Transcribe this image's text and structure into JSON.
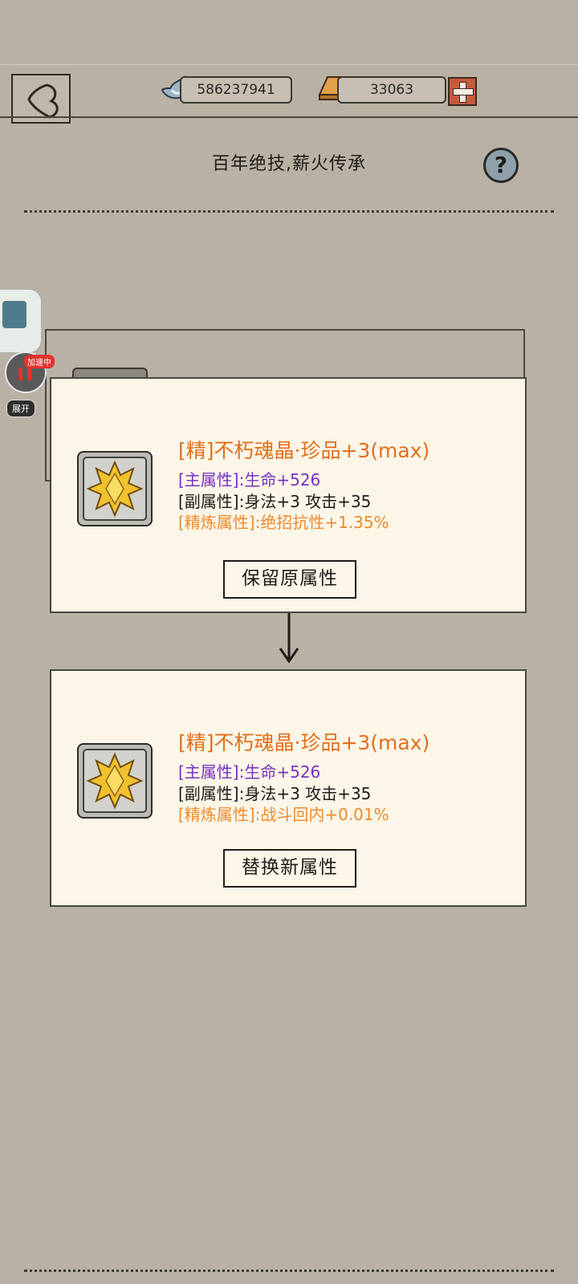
{
  "header": {
    "silver_amount": "586237941",
    "gold_amount": "33063"
  },
  "page_title": "百年绝技,薪火传承",
  "help_label": "?",
  "overlay": {
    "boost_badge": "加速中",
    "expand_label": "展开"
  },
  "current": {
    "item_name": "[精]不朽魂晶·珍品+3(max)",
    "main_attr": "[主属性]:生命+526",
    "sub_attr": "[副属性]:身法+3 攻击+35",
    "refine_attr": "[精炼属性]:绝招抗性+1.35%",
    "button_label": "保留原属性"
  },
  "new": {
    "item_name": "[精]不朽魂晶·珍品+3(max)",
    "main_attr": "[主属性]:生命+526",
    "sub_attr": "[副属性]:身法+3 攻击+35",
    "refine_attr": "[精炼属性]:战斗回内+0.01%",
    "button_label": "替换新属性"
  },
  "colors": {
    "background": "#b9b2a4",
    "card": "#fbf6e8",
    "item_name": "#e36e1c",
    "main_attr": "#7a2fc4",
    "refine_attr": "#ef8a2c"
  }
}
